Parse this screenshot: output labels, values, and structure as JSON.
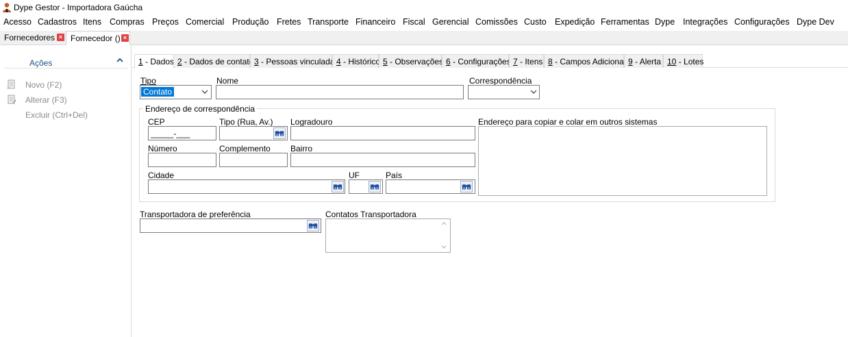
{
  "window": {
    "title": "Dype Gestor - Importadora Gaúcha"
  },
  "menu": [
    "Acesso",
    "Cadastros",
    "Itens",
    "Compras",
    "Preços",
    "Comercial",
    "Produção",
    "Fretes",
    "Transporte",
    "Financeiro",
    "Fiscal",
    "Gerencial",
    "Comissões",
    "Custo",
    "Expedição",
    "Ferramentas",
    "Dype",
    "Integrações",
    "Configurações",
    "Dype Dev"
  ],
  "doc_tabs": [
    {
      "label": "Fornecedores"
    },
    {
      "label": "Fornecedor ()"
    }
  ],
  "actions": {
    "title": "Ações",
    "items": [
      {
        "label": "Novo (F2)"
      },
      {
        "label": "Alterar (F3)"
      },
      {
        "label": "Excluir (Ctrl+Del)"
      }
    ]
  },
  "tabs": [
    {
      "num": "1",
      "label": " - Dados"
    },
    {
      "num": "2",
      "label": " - Dados de contato"
    },
    {
      "num": "3",
      "label": " - Pessoas vinculadas"
    },
    {
      "num": "4",
      "label": " - Histórico"
    },
    {
      "num": "5",
      "label": " - Observações"
    },
    {
      "num": "6",
      "label": " - Configurações"
    },
    {
      "num": "7",
      "label": " - Itens"
    },
    {
      "num": "8",
      "label": " - Campos Adicionais"
    },
    {
      "num": "9",
      "label": " - Alerta"
    },
    {
      "num": "10",
      "label": " - Lotes"
    }
  ],
  "form": {
    "tipo_label": "Tipo",
    "tipo_value": "Contato",
    "nome_label": "Nome",
    "nome_value": "",
    "correspondencia_label": "Correspondência",
    "correspondencia_value": "",
    "endereco_group": "Endereço de correspondência",
    "cep_label": "CEP",
    "cep_value": "_____-___",
    "tipo_rua_label": "Tipo (Rua, Av.)",
    "logradouro_label": "Logradouro",
    "copiar_label": "Endereço para copiar e colar em outros sistemas",
    "numero_label": "Número",
    "complemento_label": "Complemento",
    "bairro_label": "Bairro",
    "cidade_label": "Cidade",
    "uf_label": "UF",
    "pais_label": "País",
    "transportadora_label": "Transportadora de preferência",
    "contatos_transp_label": "Contatos Transportadora"
  },
  "colors": {
    "accent": "#0078d7",
    "close": "#e04343",
    "actions_title": "#1a4f8a"
  }
}
